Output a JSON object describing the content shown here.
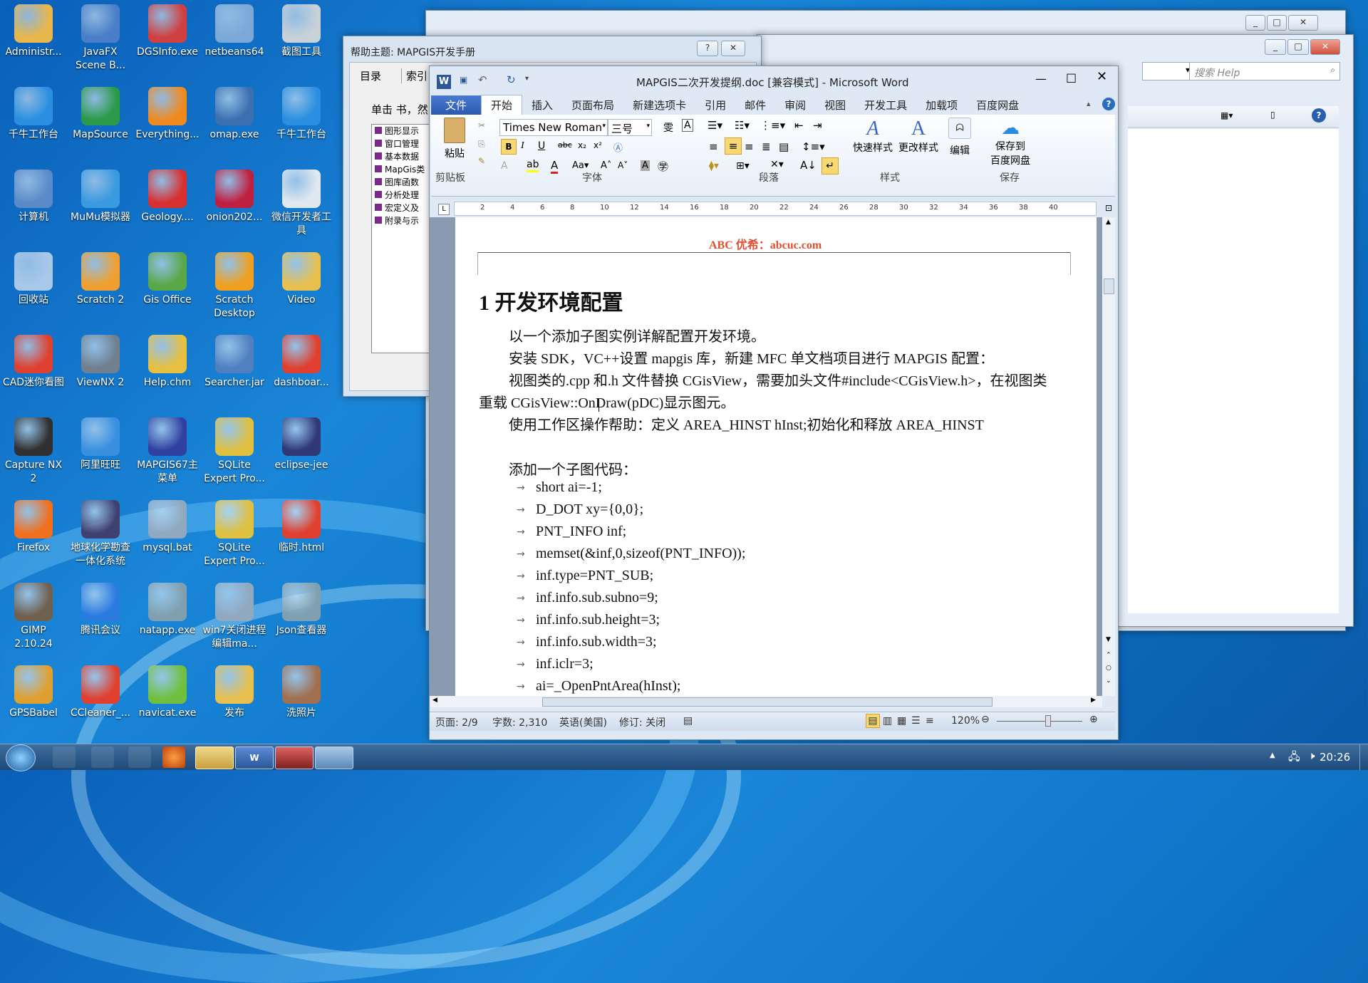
{
  "desktop_icons": [
    {
      "label": "Administr...",
      "color": "#e8b64a"
    },
    {
      "label": "JavaFX Scene B...",
      "color": "#4a7ec8"
    },
    {
      "label": "DGSInfo.exe",
      "color": "#d04040"
    },
    {
      "label": "netbeans64",
      "color": "#7aa8d8"
    },
    {
      "label": "截图工具",
      "color": "#c8d0d8"
    },
    {
      "label": "千牛工作台",
      "color": "#2a8fe0"
    },
    {
      "label": "MapSource",
      "color": "#2a9a4a"
    },
    {
      "label": "Everything...",
      "color": "#f08a20"
    },
    {
      "label": "omap.exe",
      "color": "#3a70b0"
    },
    {
      "label": "千牛工作台",
      "color": "#2a8fe0"
    },
    {
      "label": "计算机",
      "color": "#5a8ac8"
    },
    {
      "label": "MuMu模拟器",
      "color": "#3a9ae0"
    },
    {
      "label": "Geology....",
      "color": "#d83030"
    },
    {
      "label": "onion202...",
      "color": "#c02040"
    },
    {
      "label": "微信开发者工具",
      "color": "#e0e8f0"
    },
    {
      "label": "回收站",
      "color": "#a8c8e8"
    },
    {
      "label": "Scratch 2",
      "color": "#f0a030"
    },
    {
      "label": "Gis Office",
      "color": "#58a848"
    },
    {
      "label": "Scratch Desktop",
      "color": "#f0a020"
    },
    {
      "label": "Video",
      "color": "#e8c050"
    },
    {
      "label": "CAD迷你看图",
      "color": "#e04030"
    },
    {
      "label": "ViewNX 2",
      "color": "#708090"
    },
    {
      "label": "Help.chm",
      "color": "#e8c040"
    },
    {
      "label": "Searcher.jar",
      "color": "#5080c0"
    },
    {
      "label": "dashboar...",
      "color": "#e04030"
    },
    {
      "label": "Capture NX 2",
      "color": "#303030"
    },
    {
      "label": "阿里旺旺",
      "color": "#3a90e0"
    },
    {
      "label": "MAPGIS67主菜单",
      "color": "#3040a0"
    },
    {
      "label": "SQLite Expert Pro...",
      "color": "#e0c040"
    },
    {
      "label": "eclipse-jee",
      "color": "#303878"
    },
    {
      "label": "Firefox",
      "color": "#f07020"
    },
    {
      "label": "地球化学勘查一体化系统",
      "color": "#404070"
    },
    {
      "label": "mysql.bat",
      "color": "#90a8c0"
    },
    {
      "label": "SQLite Expert Pro...",
      "color": "#e0c040"
    },
    {
      "label": "临时.html",
      "color": "#e04030"
    },
    {
      "label": "GIMP 2.10.24",
      "color": "#706050"
    },
    {
      "label": "腾讯会议",
      "color": "#2a7ae0"
    },
    {
      "label": "natapp.exe",
      "color": "#80a0b0"
    },
    {
      "label": "win7关闭进程编辑ma...",
      "color": "#90a8c0"
    },
    {
      "label": "Json查看器",
      "color": "#80a0b0"
    },
    {
      "label": "GPSBabel",
      "color": "#e0a030"
    },
    {
      "label": "CCleaner_...",
      "color": "#e04030"
    },
    {
      "label": "navicat.exe",
      "color": "#70c040"
    },
    {
      "label": "发布",
      "color": "#e8c050"
    },
    {
      "label": "洗照片",
      "color": "#a07050"
    }
  ],
  "help_window": {
    "title": "帮助主题: MAPGIS开发手册",
    "tab_contents": "目录",
    "tab_index": "索引",
    "instruction": "单击 书，然",
    "tree": [
      "图形显示",
      "窗口管理",
      "基本数据",
      "MapGis类",
      "图库函数",
      "分析处理",
      "宏定义及",
      "附录与示"
    ]
  },
  "bg_window": {
    "search_placeholder": "搜索 Help"
  },
  "word": {
    "title": "MAPGIS二次开发提纲.doc [兼容模式] - Microsoft Word",
    "tabs": [
      "文件",
      "开始",
      "插入",
      "页面布局",
      "新建选项卡",
      "引用",
      "邮件",
      "审阅",
      "视图",
      "开发工具",
      "加载项",
      "百度网盘"
    ],
    "font_name": "Times New Roman",
    "font_size": "三号",
    "groups": {
      "clipboard": "剪贴板",
      "font": "字体",
      "paragraph": "段落",
      "styles": "样式",
      "save": "保存"
    },
    "buttons": {
      "paste": "粘贴",
      "quick_styles": "快速样式",
      "change_styles": "更改样式",
      "edit": "编辑",
      "save_to": "保存到",
      "baidu": "百度网盘"
    },
    "ruler_marks": [
      "2",
      "4",
      "6",
      "8",
      "10",
      "12",
      "14",
      "16",
      "18",
      "20",
      "22",
      "24",
      "26",
      "28",
      "30",
      "32",
      "34",
      "36",
      "38",
      "40"
    ],
    "header_text": "ABC 优希：abcuc.com",
    "heading": "1 开发环境配置",
    "paragraphs": [
      "以一个添加子图实例详解配置开发环境。",
      "安装 SDK，VC++设置 mapgis 库，新建 MFC 单文档项目进行 MAPGIS 配置：",
      "视图类的.cpp 和.h 文件替换 CGisView，需要加头文件#include<CGisView.h>，在视图类",
      "重载 CGisView::OnDraw(pDC)显示图元。",
      "使用工作区操作帮助：定义 AREA_HINST hInst;初始化和释放 AREA_HINST",
      "添加一个子图代码："
    ],
    "code": [
      "short ai=-1;",
      "D_DOT xy={0,0};",
      "PNT_INFO inf;",
      "memset(&inf,0,sizeof(PNT_INFO));",
      "inf.type=PNT_SUB;",
      "inf.info.sub.subno=9;",
      "inf.info.sub.height=3;",
      "inf.info.sub.width=3;",
      "inf.iclr=3;",
      "ai=_OpenPntArea(hInst);"
    ],
    "status": {
      "page": "页面: 2/9",
      "words": "字数: 2,310",
      "lang": "英语(美国)",
      "track": "修订: 关闭",
      "zoom": "120%"
    }
  },
  "taskbar": {
    "time": "20:26"
  }
}
